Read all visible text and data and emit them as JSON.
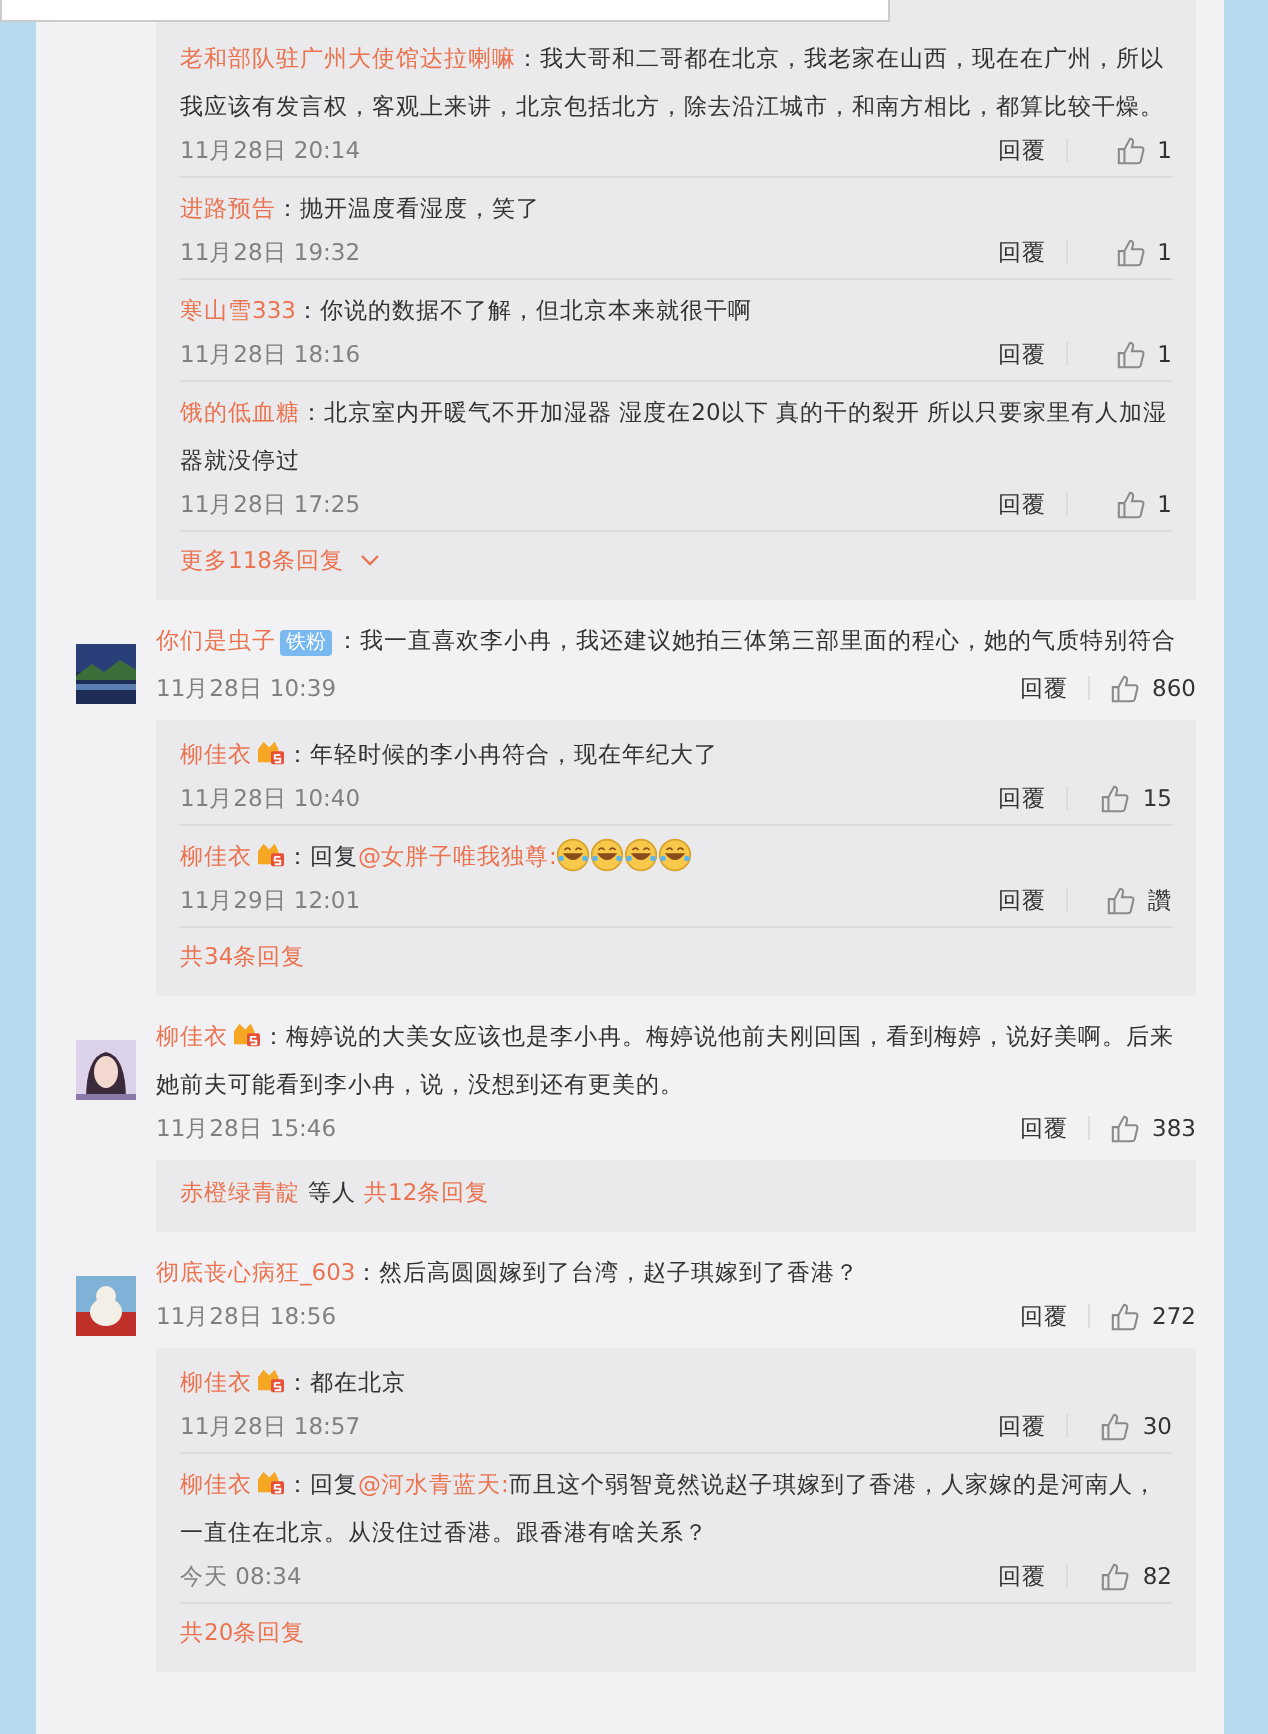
{
  "threads": [
    {
      "kind": "replies-only",
      "replies": [
        {
          "user": "老和部队驻广州大使馆达拉喇嘛",
          "vip": false,
          "parts": [
            {
              "kind": "text",
              "text": "：我大哥和二哥都在北京，我老家在山西，现在在广州，所以我应该有发言权，客观上来讲，北京包括北方，除去沿江城市，和南方相比，都算比较干燥。"
            }
          ],
          "time": "11月28日 20:14",
          "reply": "回覆",
          "likes": "1"
        },
        {
          "user": "进路预告",
          "vip": false,
          "parts": [
            {
              "kind": "text",
              "text": "：抛开温度看湿度，笑了"
            }
          ],
          "time": "11月28日 19:32",
          "reply": "回覆",
          "likes": "1"
        },
        {
          "user": "寒山雪333",
          "vip": false,
          "parts": [
            {
              "kind": "text",
              "text": "：你说的数据不了解，但北京本来就很干啊"
            }
          ],
          "time": "11月28日 18:16",
          "reply": "回覆",
          "likes": "1"
        },
        {
          "user": "饿的低血糖",
          "vip": false,
          "parts": [
            {
              "kind": "text",
              "text": "：北京室内开暖气不开加湿器 湿度在20以下 真的干的裂开 所以只要家里有人加湿器就没停过"
            }
          ],
          "time": "11月28日 17:25",
          "reply": "回覆",
          "likes": "1"
        }
      ],
      "footer": {
        "kind": "more",
        "link": "更多118条回复"
      }
    },
    {
      "kind": "comment",
      "user": "你们是虫子",
      "badge": "铁粉",
      "vip": false,
      "text": "：我一直喜欢李小冉，我还建议她拍三体第三部里面的程心，她的气质特别符合",
      "time": "11月28日 10:39",
      "reply": "回覆",
      "likes": "860",
      "replies": [
        {
          "user": "柳佳衣",
          "vip": true,
          "parts": [
            {
              "kind": "text",
              "text": "：年轻时候的李小冉符合，现在年纪大了"
            }
          ],
          "time": "11月28日 10:40",
          "reply": "回覆",
          "likes": "15"
        },
        {
          "user": "柳佳衣",
          "vip": true,
          "parts": [
            {
              "kind": "text",
              "text": "：回复"
            },
            {
              "kind": "mention",
              "text": "@女胖子唯我独尊:"
            },
            {
              "kind": "emoji"
            },
            {
              "kind": "emoji"
            },
            {
              "kind": "emoji"
            },
            {
              "kind": "emoji"
            }
          ],
          "time": "11月29日 12:01",
          "reply": "回覆",
          "likes": "讚"
        }
      ],
      "footer": {
        "kind": "total",
        "link": "共34条回复"
      }
    },
    {
      "kind": "comment",
      "user": "柳佳衣",
      "vip": true,
      "text": "：梅婷说的大美女应该也是李小冉。梅婷说他前夫刚回国，看到梅婷，说好美啊。后来她前夫可能看到李小冉，说，没想到还有更美的。",
      "time": "11月28日 15:46",
      "reply": "回覆",
      "likes": "383",
      "footer": {
        "kind": "others",
        "names": "赤橙绿青靛",
        "joiner": "等人",
        "link": "共12条回复"
      }
    },
    {
      "kind": "comment",
      "user": "彻底丧心病狂_603",
      "vip": false,
      "text": "：然后高圆圆嫁到了台湾，赵子琪嫁到了香港？",
      "time": "11月28日 18:56",
      "reply": "回覆",
      "likes": "272",
      "replies": [
        {
          "user": "柳佳衣",
          "vip": true,
          "parts": [
            {
              "kind": "text",
              "text": "：都在北京"
            }
          ],
          "time": "11月28日 18:57",
          "reply": "回覆",
          "likes": "30"
        },
        {
          "user": "柳佳衣",
          "vip": true,
          "parts": [
            {
              "kind": "text",
              "text": "：回复"
            },
            {
              "kind": "mention",
              "text": "@河水青蓝天:"
            },
            {
              "kind": "text",
              "text": "而且这个弱智竟然说赵子琪嫁到了香港，人家嫁的是河南人，一直住在北京。从没住过香港。跟香港有啥关系？"
            }
          ],
          "time": "今天 08:34",
          "reply": "回覆",
          "likes": "82"
        }
      ],
      "footer": {
        "kind": "total",
        "link": "共20条回复"
      }
    }
  ]
}
